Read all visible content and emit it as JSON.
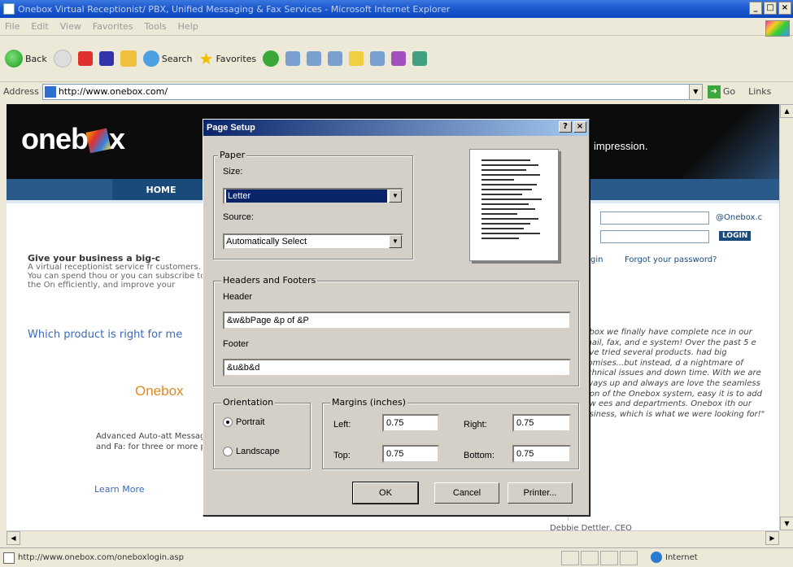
{
  "window": {
    "title": "Onebox Virtual Receptionist/ PBX, Unified Messaging & Fax Services - Microsoft Internet Explorer",
    "min_label": "_",
    "max_label": "□",
    "close_label": "×"
  },
  "menu": [
    "File",
    "Edit",
    "View",
    "Favorites",
    "Tools",
    "Help"
  ],
  "toolbar": {
    "back_label": "Back",
    "search_label": "Search",
    "favorites_label": "Favorites"
  },
  "address": {
    "label": "Address",
    "url": "http://www.onebox.com/",
    "go_label": "Go",
    "links_label": "Links"
  },
  "site": {
    "logo_text_a": "oneb",
    "logo_text_b": "x",
    "slogan": "impression.",
    "nav_home": "HOME",
    "login_suffix": "@Onebox.c",
    "login_button": "LOGIN",
    "login_signin": "gin",
    "forgot_password": "Forgot your password?",
    "intro_head": "Give your business a big-c",
    "intro_body": "A virtual receptionist service fr customers. You can spend thou or you can subscribe to the On efficiently, and improve your",
    "which_product": "Which product is right for me",
    "product_title": "Onebox",
    "advanced_copy": "Advanced Auto-att Messaging, and Fa: for three or more p",
    "learn_more": "Learn More",
    "testimonial": "nebox we finally have complete nce in our email, fax, and e system! Over the past 5 e have tried several products. had big promises...but instead, d a nightmare of technical issues and down time. With we are always up and always are love the seamless ation of the Onebox system, easy it is to add new ees and departments. Onebox ith our business, which is what we were looking for!\"",
    "signature": "Debbie Dettler, CEO"
  },
  "dialog": {
    "title": "Page Setup",
    "help_label": "?",
    "close_label": "×",
    "paper_group": "Paper",
    "size_label": "Size:",
    "size_value": "Letter",
    "source_label": "Source:",
    "source_value": "Automatically Select",
    "hf_group": "Headers and Footers",
    "header_label": "Header",
    "header_value": "&w&bPage &p of &P",
    "footer_label": "Footer",
    "footer_value": "&u&b&d",
    "orientation_group": "Orientation",
    "portrait_label": "Portrait",
    "landscape_label": "Landscape",
    "orientation_selected": "Portrait",
    "margins_group": "Margins (inches)",
    "left_label": "Left:",
    "left_value": "0.75",
    "right_label": "Right:",
    "right_value": "0.75",
    "top_label": "Top:",
    "top_value": "0.75",
    "bottom_label": "Bottom:",
    "bottom_value": "0.75",
    "ok_label": "OK",
    "cancel_label": "Cancel",
    "printer_label": "Printer..."
  },
  "status": {
    "text": "http://www.onebox.com/oneboxlogin.asp",
    "zone": "Internet"
  }
}
